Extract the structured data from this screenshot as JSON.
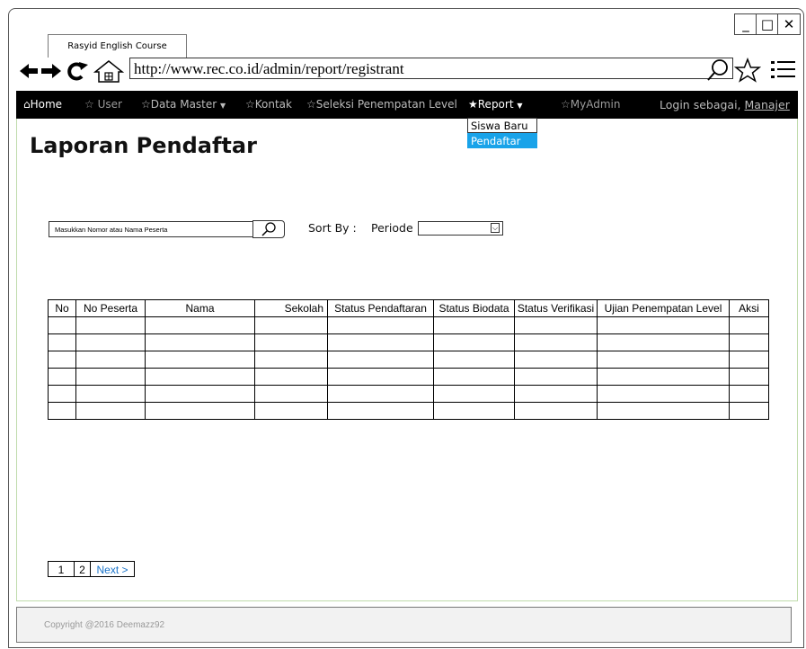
{
  "browser": {
    "tab_title": "Rasyid English Course",
    "url": "http://www.rec.co.id/admin/report/registrant",
    "nav_icons": {
      "back": "←",
      "forward": "→",
      "reload": "C",
      "home": "⌂"
    },
    "controls": {
      "minimize": "_",
      "maximize": "□",
      "close": "✕"
    },
    "search_glyph": "⌕",
    "star_glyph": "☆",
    "menu_glyph": "☰"
  },
  "menu": {
    "home": "⌂Home",
    "user": "☆ User",
    "data_master": "☆Data Master",
    "kontak": "☆Kontak",
    "seleksi": "☆Seleksi Penempatan Level",
    "report": "★Report",
    "myadmin": "☆MyAdmin",
    "login_prefix": "Login sebagai, ",
    "login_user": "Manajer",
    "caret": "▼"
  },
  "report_dropdown": {
    "items": [
      "Siswa Baru",
      "Pendaftar"
    ],
    "selected": "Pendaftar"
  },
  "page": {
    "title": "Laporan Pendaftar",
    "search_placeholder": "Masukkan Nomor atau Nama Peserta",
    "sort_label": "Sort By :",
    "periode_label": "Periode",
    "periode_value": ""
  },
  "table": {
    "headers": [
      "No",
      "No Peserta",
      "Nama",
      "Sekolah",
      "Status Pendaftaran",
      "Status Biodata",
      "Status Verifikasi",
      "Ujian Penempatan Level",
      "Aksi"
    ],
    "rows": [
      [
        "",
        "",
        "",
        "",
        "",
        "",
        "",
        "",
        ""
      ],
      [
        "",
        "",
        "",
        "",
        "",
        "",
        "",
        "",
        ""
      ],
      [
        "",
        "",
        "",
        "",
        "",
        "",
        "",
        "",
        ""
      ],
      [
        "",
        "",
        "",
        "",
        "",
        "",
        "",
        "",
        ""
      ],
      [
        "",
        "",
        "",
        "",
        "",
        "",
        "",
        "",
        ""
      ],
      [
        "",
        "",
        "",
        "",
        "",
        "",
        "",
        "",
        ""
      ]
    ]
  },
  "pagination": {
    "pages": [
      "1",
      "2"
    ],
    "next": "Next >",
    "current": "1"
  },
  "footer": {
    "copyright": "Copyright @2016 Deemazz92"
  },
  "colors": {
    "menubar": "#000000",
    "dropdown_selected": "#19a3e9",
    "link": "#1a73c9"
  }
}
